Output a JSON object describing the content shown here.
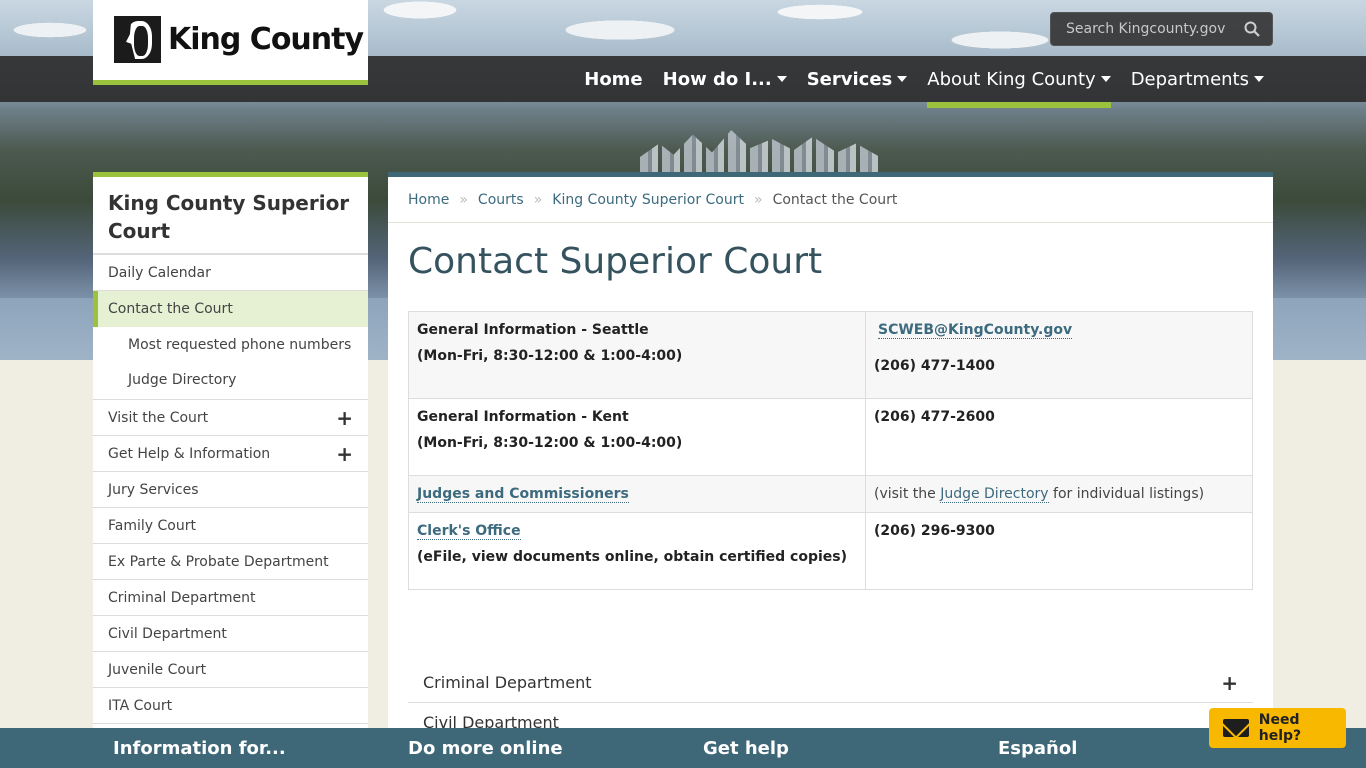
{
  "search": {
    "placeholder": "Search Kingcounty.gov"
  },
  "logo": {
    "text": "King County"
  },
  "nav": {
    "home": "Home",
    "how": "How do I...",
    "services": "Services",
    "about": "About King County",
    "departments": "Departments"
  },
  "sidebar": {
    "title": "King County Superior Court",
    "items": [
      "Daily Calendar",
      "Contact the Court",
      "Most requested phone numbers",
      "Judge Directory",
      "Visit the Court",
      "Get Help & Information",
      "Jury Services",
      "Family Court",
      "Ex Parte & Probate Department",
      "Criminal Department",
      "Civil Department",
      "Juvenile Court",
      "ITA Court"
    ],
    "plus": "+"
  },
  "breadcrumb": [
    "Home",
    "Courts",
    "King County Superior Court",
    "Contact the Court"
  ],
  "page": {
    "title": "Contact Superior Court"
  },
  "table": {
    "r1": {
      "label": "General Information - Seattle",
      "hours": "(Mon-Fri, 8:30-12:00 & 1:00-4:00)",
      "email": "SCWEB@KingCounty.gov",
      "phone": "(206) 477-1400"
    },
    "r2": {
      "label": "General Information - Kent",
      "hours": "(Mon-Fri, 8:30-12:00 & 1:00-4:00)",
      "phone": "(206) 477-2600"
    },
    "r3": {
      "label": "Judges and Commissioners",
      "pre": "(visit the ",
      "link": "Judge Directory",
      "post": " for individual listings)"
    },
    "r4": {
      "label": "Clerk's Office",
      "desc": "(eFile, view documents online, obtain certified copies)",
      "phone": "(206) 296-9300"
    }
  },
  "accordion": [
    "Criminal Department",
    "Civil Department"
  ],
  "footer": [
    "Information for...",
    "Do more online",
    "Get help",
    "Español"
  ],
  "help": "Need help?"
}
